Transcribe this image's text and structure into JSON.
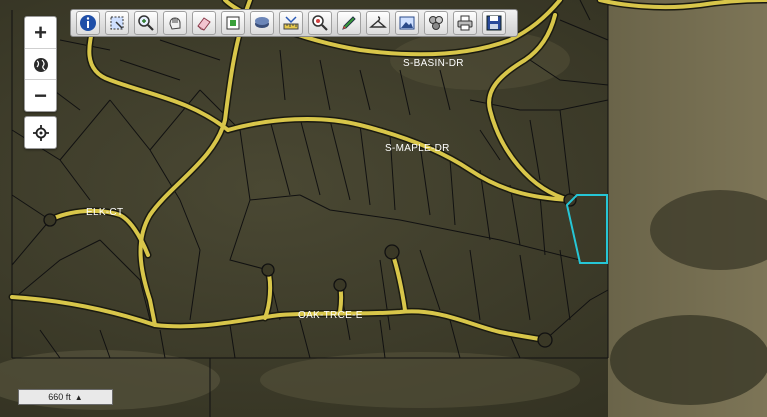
{
  "map": {
    "streets": [
      {
        "name": "S-BASIN-DR"
      },
      {
        "name": "S-MAPLE-DR"
      },
      {
        "name": "ELK-CT"
      },
      {
        "name": "OAK-TRCE-E"
      }
    ],
    "highlight_color": "#26c6d6",
    "parcel_line_color": "#111111",
    "road_color": "#d8c64a"
  },
  "controls": {
    "zoom_in": "+",
    "zoom_out": "−",
    "globe_icon": "globe-icon",
    "locate_icon": "crosshair-icon"
  },
  "toolbar": {
    "tools": [
      {
        "name": "info-icon"
      },
      {
        "name": "select-box-icon"
      },
      {
        "name": "zoom-in-icon"
      },
      {
        "name": "pan-hand-icon"
      },
      {
        "name": "eraser-icon"
      },
      {
        "name": "select-features-icon"
      },
      {
        "name": "layers-icon"
      },
      {
        "name": "measure-icon"
      },
      {
        "name": "find-icon"
      },
      {
        "name": "draw-pencil-icon"
      },
      {
        "name": "hanger-icon"
      },
      {
        "name": "image-icon"
      },
      {
        "name": "buffer-icon"
      },
      {
        "name": "print-icon"
      },
      {
        "name": "save-icon"
      }
    ]
  },
  "scale_bar": {
    "label": "660 ft",
    "arrow": "▲"
  }
}
